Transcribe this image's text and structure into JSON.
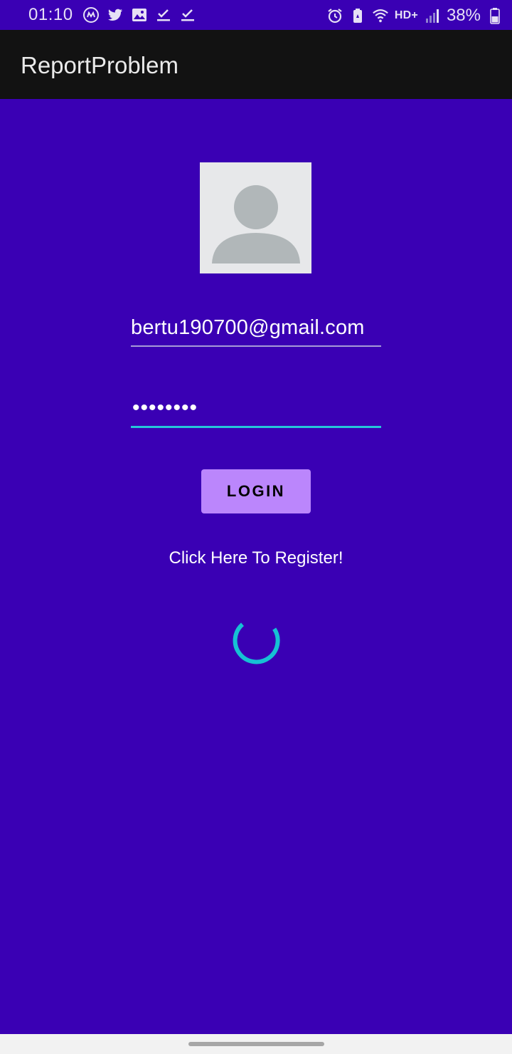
{
  "status_bar": {
    "time": "01:10",
    "left_icons": [
      "assistant-icon",
      "twitter-icon",
      "gallery-icon",
      "checklist-icon",
      "checklist-icon"
    ],
    "right_icons": [
      "alarm-icon",
      "battery-saver-icon",
      "wifi-icon",
      "signal-icon"
    ],
    "network_label": "HD+",
    "battery_percent": "38%",
    "text_color": "#e6e0f5"
  },
  "app_bar": {
    "title": "ReportProblem",
    "background": "#121212"
  },
  "login_form": {
    "email_value": "bertu190700@gmail.com",
    "password_value": "••••••••",
    "login_label": "LOGIN",
    "register_label": "Click Here To Register!"
  },
  "colors": {
    "background": "#3a00b4",
    "button": "#bb86fc",
    "accent": "#25c6d9"
  },
  "loading": {
    "spinner_icon": "progress-spinner-icon"
  }
}
